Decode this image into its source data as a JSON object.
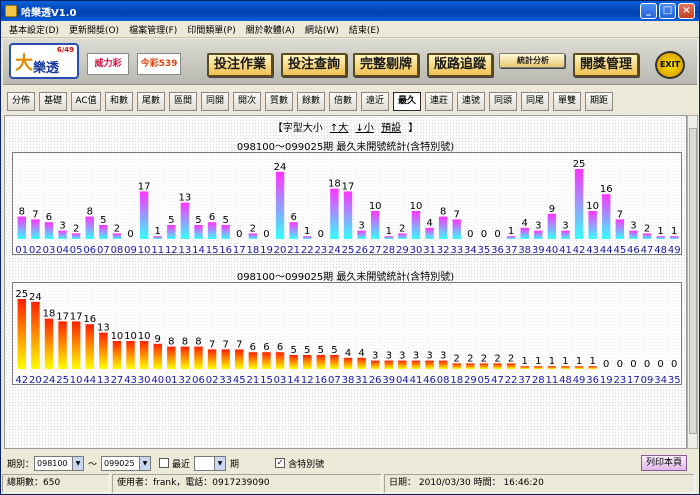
{
  "window": {
    "title": "哈樂透V1.0",
    "min": "_",
    "max": "□",
    "close": "×"
  },
  "menu": [
    "基本設定(D)",
    "更新開獎(O)",
    "檔案管理(F)",
    "印間類單(P)",
    "關於軟體(A)",
    "網站(W)",
    "結束(E)"
  ],
  "logos": {
    "main_big": "大",
    "main_text": "樂透",
    "main_num": "6/49",
    "b1": "威力彩",
    "b2": "今彩539"
  },
  "nav_buttons": [
    "投注作業",
    "投注查詢",
    "完整剔牌",
    "版路追蹤",
    "統計分析",
    "開獎管理"
  ],
  "exit_label": "EXIT",
  "tabs": [
    "分佈",
    "基礎",
    "AC值",
    "和數",
    "尾數",
    "區間",
    "同開",
    "開次",
    "質數",
    "餘數",
    "倍數",
    "遠近",
    "最久",
    "連莊",
    "連號",
    "同頭",
    "同尾",
    "單雙",
    "期距"
  ],
  "active_tab": "最久",
  "font_row": {
    "prefix": "【字型大小",
    "bigger": "↑大",
    "smaller": "↓小",
    "preset": "預設",
    "suffix": "】"
  },
  "chart_titles": [
    "098100～099025期 最久未開號統計(含特別號)",
    "098100～099025期 最久未開號統計(含特別號)"
  ],
  "chart_data": [
    {
      "type": "bar",
      "categories": [
        "01",
        "02",
        "03",
        "04",
        "05",
        "06",
        "07",
        "08",
        "09",
        "10",
        "11",
        "12",
        "13",
        "14",
        "15",
        "16",
        "17",
        "18",
        "19",
        "20",
        "21",
        "22",
        "23",
        "24",
        "25",
        "26",
        "27",
        "28",
        "29",
        "30",
        "31",
        "32",
        "33",
        "34",
        "35",
        "36",
        "37",
        "38",
        "39",
        "40",
        "41",
        "42",
        "43",
        "44",
        "45",
        "46",
        "47",
        "48",
        "49"
      ],
      "values": [
        8,
        7,
        6,
        3,
        2,
        8,
        5,
        2,
        0,
        17,
        1,
        5,
        13,
        5,
        6,
        5,
        0,
        2,
        0,
        24,
        6,
        1,
        0,
        18,
        17,
        3,
        10,
        1,
        2,
        10,
        4,
        8,
        7,
        0,
        0,
        0,
        1,
        4,
        3,
        9,
        3,
        25,
        10,
        16,
        7,
        3,
        2,
        1,
        1
      ],
      "title": "098100～099025期 最久未開號統計(含特別號)",
      "ylim": [
        0,
        25
      ],
      "colors": {
        "top": "#ff33ff",
        "bottom": "#33ffff"
      }
    },
    {
      "type": "bar",
      "categories": [
        "42",
        "20",
        "24",
        "25",
        "10",
        "44",
        "13",
        "27",
        "43",
        "30",
        "40",
        "01",
        "32",
        "06",
        "02",
        "33",
        "45",
        "21",
        "15",
        "03",
        "14",
        "12",
        "16",
        "07",
        "38",
        "31",
        "26",
        "39",
        "04",
        "41",
        "46",
        "08",
        "18",
        "29",
        "05",
        "47",
        "22",
        "37",
        "28",
        "11",
        "48",
        "49",
        "36",
        "19",
        "23",
        "17",
        "09",
        "34",
        "35"
      ],
      "values": [
        25,
        24,
        18,
        17,
        17,
        16,
        13,
        10,
        10,
        10,
        9,
        8,
        8,
        8,
        7,
        7,
        7,
        6,
        6,
        6,
        5,
        5,
        5,
        5,
        4,
        4,
        3,
        3,
        3,
        3,
        3,
        3,
        2,
        2,
        2,
        2,
        2,
        1,
        1,
        1,
        1,
        1,
        1,
        0,
        0,
        0,
        0,
        0,
        0
      ],
      "title": "098100～099025期 最久未開號統計(含特別號)",
      "ylim": [
        0,
        25
      ],
      "colors": {
        "top": "#ff2000",
        "bottom": "#ffff00"
      }
    }
  ],
  "status_row": {
    "period_label": "期別：",
    "from": "098100",
    "tilde": "～",
    "to": "099025",
    "recent_label": "最近",
    "period_unit": "期",
    "include_special": "含特別號",
    "include_checked": "✓",
    "print_label": "列印本頁"
  },
  "footer": {
    "total": "總期數：650",
    "user": "使用者：frank，電話：0917239090",
    "date": "日期： 2010/03/30   時間： 16:46:20"
  }
}
